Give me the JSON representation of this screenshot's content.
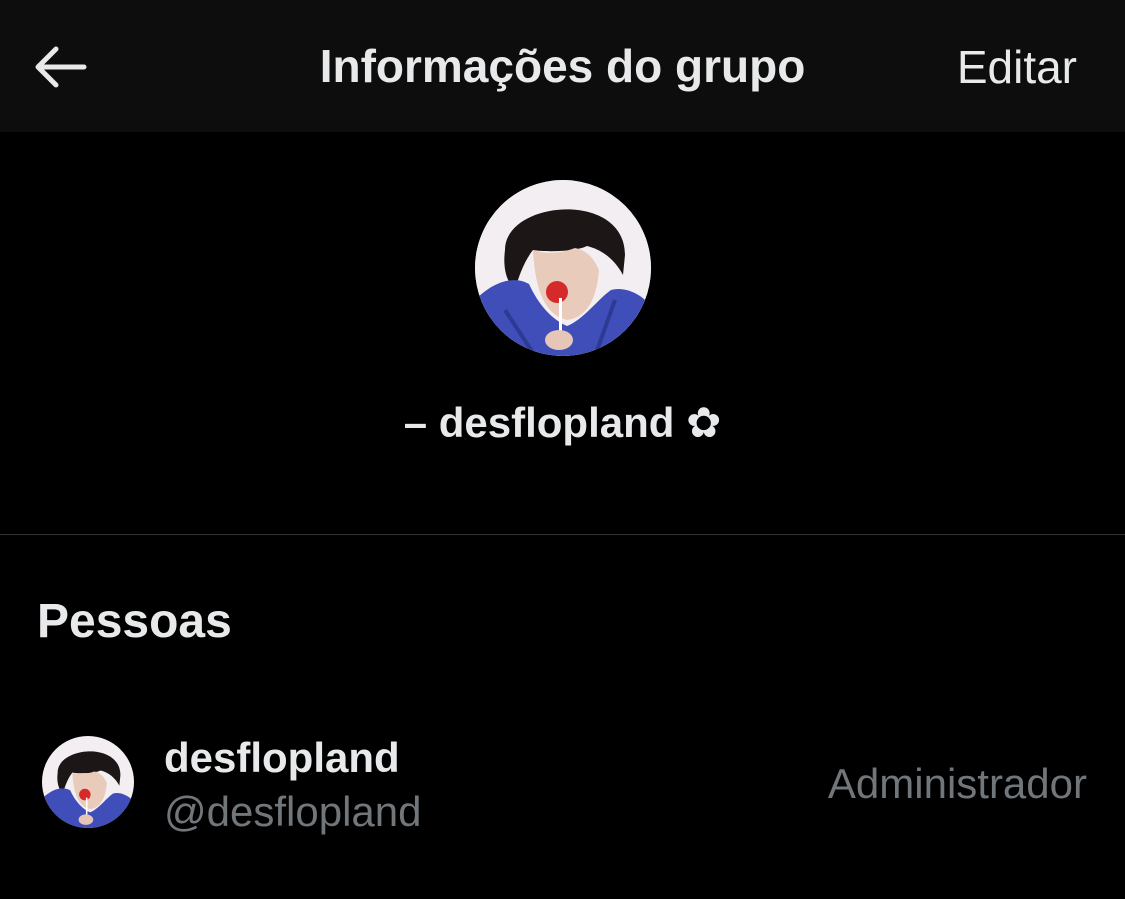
{
  "header": {
    "back_icon": "arrow-left-icon",
    "title": "Informações do grupo",
    "edit_label": "Editar"
  },
  "group": {
    "avatar": "group-avatar-photo",
    "name": "– desflopland ✿"
  },
  "people": {
    "section_title": "Pessoas",
    "members": [
      {
        "name": "desflopland",
        "handle": "@desflopland",
        "role": "Administrador"
      }
    ]
  },
  "colors": {
    "background": "#000000",
    "header_background": "#0d0d0d",
    "primary_text": "#e7e9ea",
    "secondary_text": "#71767b",
    "divider": "#2f3336"
  }
}
